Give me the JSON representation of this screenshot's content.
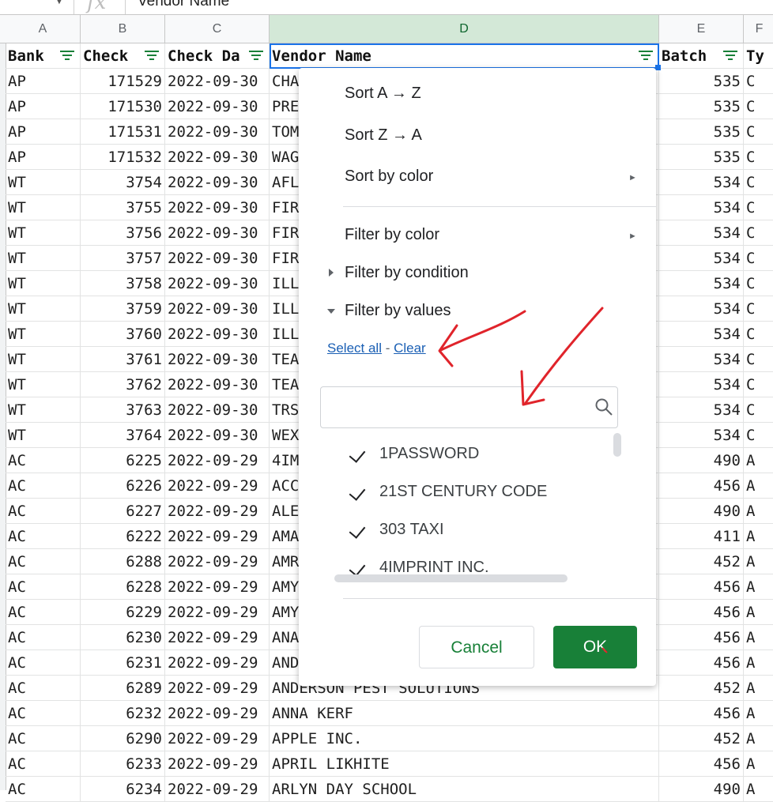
{
  "formula_bar": {
    "content": "Vendor Name"
  },
  "column_letters": [
    "A",
    "B",
    "C",
    "D",
    "E",
    "F"
  ],
  "headers": [
    "Bank",
    "Check",
    "Check Da",
    "Vendor Name",
    "Batch",
    "Ty"
  ],
  "rows": [
    [
      "AP",
      "171529",
      "2022-09-30",
      "CHA",
      "535",
      "C"
    ],
    [
      "AP",
      "171530",
      "2022-09-30",
      "PRE",
      "535",
      "C"
    ],
    [
      "AP",
      "171531",
      "2022-09-30",
      "TOM",
      "535",
      "C"
    ],
    [
      "AP",
      "171532",
      "2022-09-30",
      "WAG",
      "535",
      "C"
    ],
    [
      "WT",
      "3754",
      "2022-09-30",
      "AFL",
      "534",
      "C"
    ],
    [
      "WT",
      "3755",
      "2022-09-30",
      "FIR",
      "534",
      "C"
    ],
    [
      "WT",
      "3756",
      "2022-09-30",
      "FIR",
      "534",
      "C"
    ],
    [
      "WT",
      "3757",
      "2022-09-30",
      "FIR",
      "534",
      "C"
    ],
    [
      "WT",
      "3758",
      "2022-09-30",
      "ILL",
      "534",
      "C"
    ],
    [
      "WT",
      "3759",
      "2022-09-30",
      "ILL",
      "534",
      "C"
    ],
    [
      "WT",
      "3760",
      "2022-09-30",
      "ILL",
      "534",
      "C"
    ],
    [
      "WT",
      "3761",
      "2022-09-30",
      "TEA",
      "534",
      "C"
    ],
    [
      "WT",
      "3762",
      "2022-09-30",
      "TEA",
      "534",
      "C"
    ],
    [
      "WT",
      "3763",
      "2022-09-30",
      "TRS",
      "534",
      "C"
    ],
    [
      "WT",
      "3764",
      "2022-09-30",
      "WEX",
      "534",
      "C"
    ],
    [
      "AC",
      "6225",
      "2022-09-29",
      "4IM",
      "490",
      "A"
    ],
    [
      "AC",
      "6226",
      "2022-09-29",
      "ACC",
      "456",
      "A"
    ],
    [
      "AC",
      "6227",
      "2022-09-29",
      "ALE",
      "490",
      "A"
    ],
    [
      "AC",
      "6222",
      "2022-09-29",
      "AMA",
      "411",
      "A"
    ],
    [
      "AC",
      "6288",
      "2022-09-29",
      "AMR",
      "452",
      "A"
    ],
    [
      "AC",
      "6228",
      "2022-09-29",
      "AMY",
      "456",
      "A"
    ],
    [
      "AC",
      "6229",
      "2022-09-29",
      "AMY",
      "456",
      "A"
    ],
    [
      "AC",
      "6230",
      "2022-09-29",
      "ANA",
      "456",
      "A"
    ],
    [
      "AC",
      "6231",
      "2022-09-29",
      "AND",
      "456",
      "A"
    ],
    [
      "AC",
      "6289",
      "2022-09-29",
      "ANDERSON PEST SOLUTIONS",
      "452",
      "A"
    ],
    [
      "AC",
      "6232",
      "2022-09-29",
      "ANNA KERF",
      "456",
      "A"
    ],
    [
      "AC",
      "6290",
      "2022-09-29",
      "APPLE INC.",
      "452",
      "A"
    ],
    [
      "AC",
      "6233",
      "2022-09-29",
      "APRIL LIKHITE",
      "456",
      "A"
    ],
    [
      "AC",
      "6234",
      "2022-09-29",
      "ARLYN DAY SCHOOL",
      "490",
      "A"
    ]
  ],
  "filter_menu": {
    "sort_az": "Sort A → Z",
    "sort_za": "Sort Z → A",
    "sort_by_color": "Sort by color",
    "filter_by_color": "Filter by color",
    "filter_by_condition": "Filter by condition",
    "filter_by_values": "Filter by values",
    "select_all": "Select all",
    "link_separator": " - ",
    "clear": "Clear",
    "submenu_arrow": "►",
    "search_placeholder": "",
    "values": [
      "1PASSWORD",
      "21ST CENTURY CODE",
      "303 TAXI",
      "4IMPRINT INC."
    ],
    "cancel": "Cancel",
    "ok": "OK"
  },
  "colors": {
    "accent": "#188038",
    "selection": "#1a73e8",
    "annotation": "#e0242b"
  }
}
